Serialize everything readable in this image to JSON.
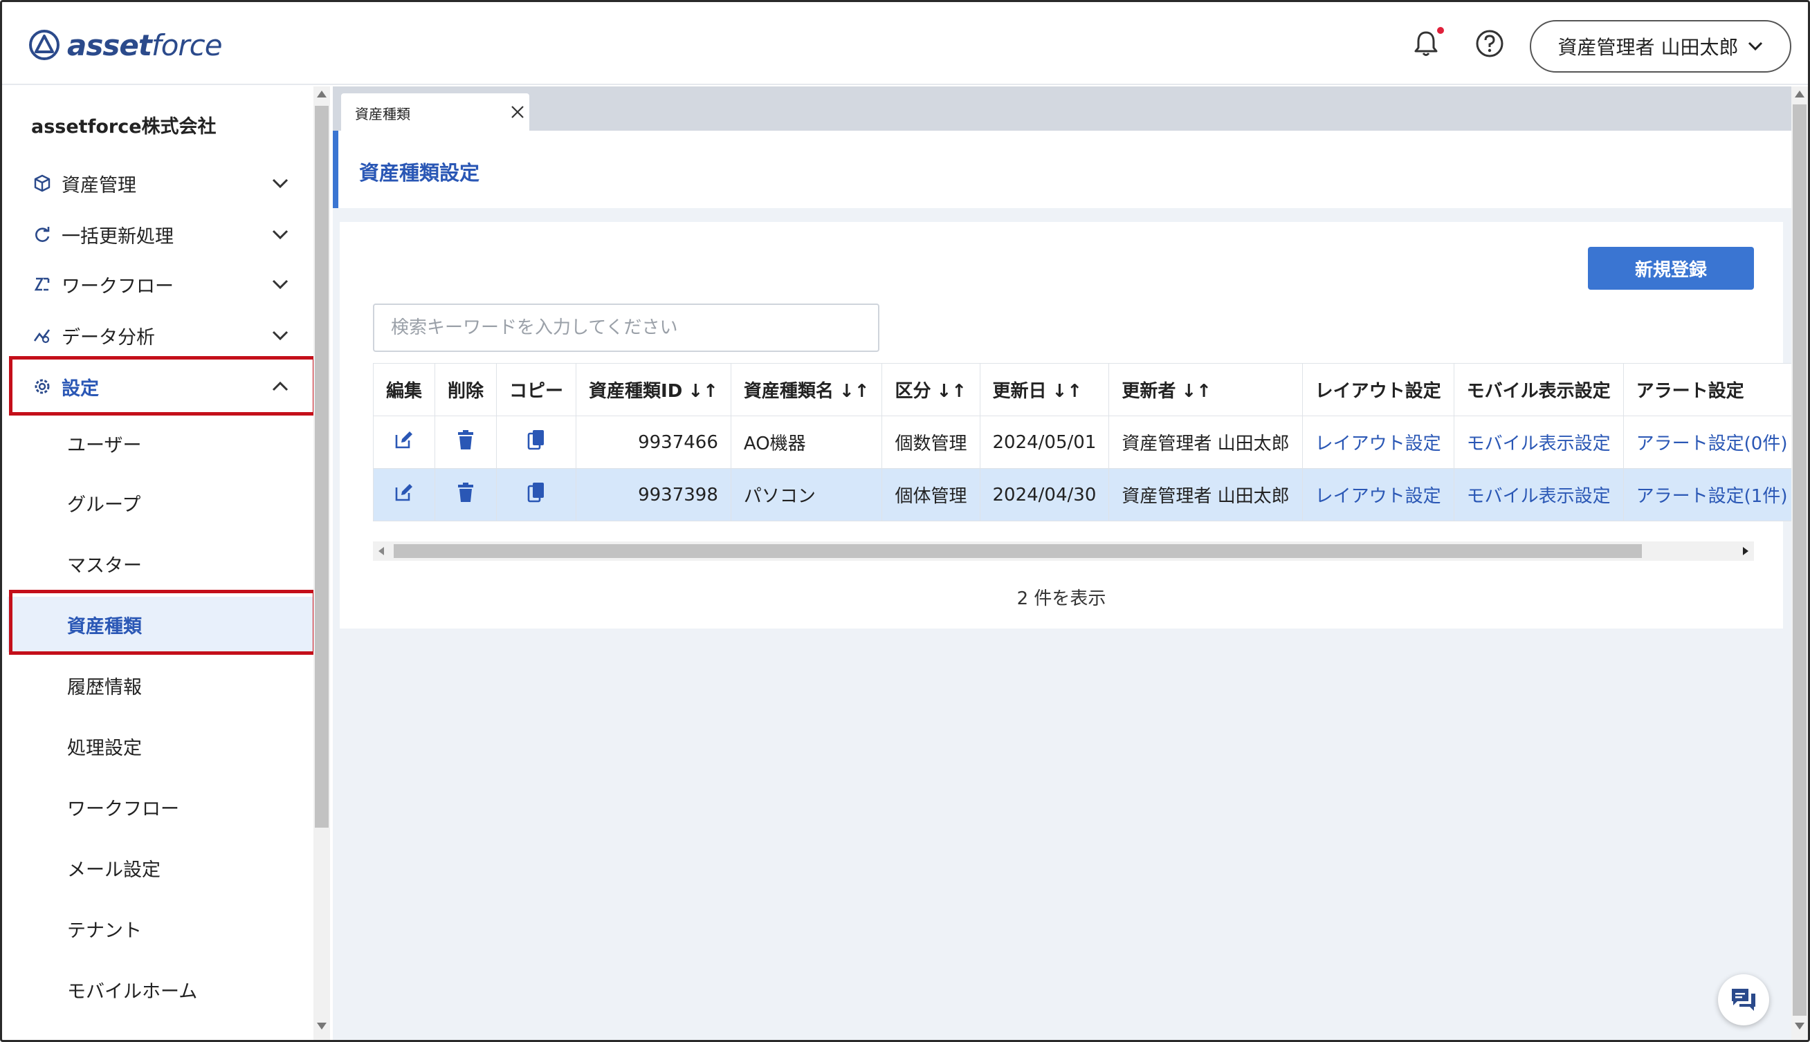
{
  "header": {
    "logo_text_bold": "asset",
    "logo_text_light": "force",
    "user_label": "資産管理者 山田太郎"
  },
  "sidebar": {
    "company": "assetforce株式会社",
    "items": [
      {
        "label": "資産管理"
      },
      {
        "label": "一括更新処理"
      },
      {
        "label": "ワークフロー"
      },
      {
        "label": "データ分析"
      },
      {
        "label": "設定"
      }
    ],
    "sub_items": [
      {
        "label": "ユーザー"
      },
      {
        "label": "グループ"
      },
      {
        "label": "マスター"
      },
      {
        "label": "資産種類"
      },
      {
        "label": "履歴情報"
      },
      {
        "label": "処理設定"
      },
      {
        "label": "ワークフロー"
      },
      {
        "label": "メール設定"
      },
      {
        "label": "テナント"
      },
      {
        "label": "モバイルホーム"
      }
    ]
  },
  "tabs": [
    {
      "label": "資産種類"
    }
  ],
  "page": {
    "title": "資産種類設定",
    "new_button": "新規登録",
    "search_placeholder": "検索キーワードを入力してください",
    "count_text": "2 件を表示"
  },
  "table": {
    "headers": {
      "edit": "編集",
      "delete": "削除",
      "copy": "コピー",
      "id": "資産種類ID",
      "name": "資産種類名",
      "category": "区分",
      "updated": "更新日",
      "updater": "更新者",
      "layout": "レイアウト設定",
      "mobile": "モバイル表示設定",
      "alert": "アラート設定"
    },
    "rows": [
      {
        "id": "9937466",
        "name": "AO機器",
        "category": "個数管理",
        "updated": "2024/05/01",
        "updater": "資産管理者 山田太郎",
        "layout": "レイアウト設定",
        "mobile": "モバイル表示設定",
        "alert": "アラート設定(0件)"
      },
      {
        "id": "9937398",
        "name": "パソコン",
        "category": "個体管理",
        "updated": "2024/04/30",
        "updater": "資産管理者 山田太郎",
        "layout": "レイアウト設定",
        "mobile": "モバイル表示設定",
        "alert": "アラート設定(1件)"
      }
    ]
  },
  "colors": {
    "accent": "#3a75d2",
    "link": "#2a57b5",
    "highlight_border": "#c40f1a",
    "selected_row": "#d6e7fa"
  }
}
